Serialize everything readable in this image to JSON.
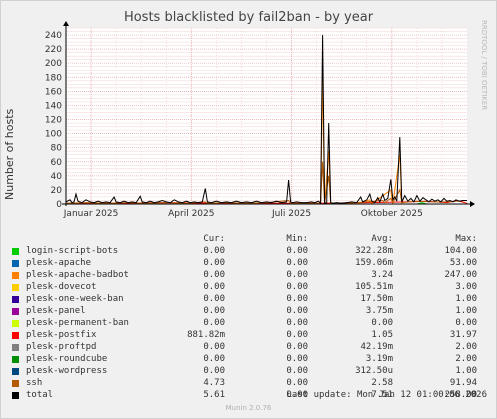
{
  "title": "Hosts blacklisted by fail2ban - by year",
  "watermark": "RRDTOOL / TOBI OETIKER",
  "footer": "Munin 2.0.76",
  "last_update": "Last update: Mon Jan 12 01:00:06 2026",
  "legend_headers": {
    "cur": "Cur:",
    "min": "Min:",
    "avg": "Avg:",
    "max": "Max:"
  },
  "legend": [
    {
      "name": "login-script-bots",
      "color": "#00cc00",
      "cur": "0.00",
      "min": "0.00",
      "avg": "322.28m",
      "max": "104.00"
    },
    {
      "name": "plesk-apache",
      "color": "#0066b3",
      "cur": "0.00",
      "min": "0.00",
      "avg": "159.06m",
      "max": "53.00"
    },
    {
      "name": "plesk-apache-badbot",
      "color": "#ff8000",
      "cur": "0.00",
      "min": "0.00",
      "avg": "3.24",
      "max": "247.00"
    },
    {
      "name": "plesk-dovecot",
      "color": "#ffcc00",
      "cur": "0.00",
      "min": "0.00",
      "avg": "105.51m",
      "max": "3.00"
    },
    {
      "name": "plesk-one-week-ban",
      "color": "#330099",
      "cur": "0.00",
      "min": "0.00",
      "avg": "17.50m",
      "max": "1.00"
    },
    {
      "name": "plesk-panel",
      "color": "#990099",
      "cur": "0.00",
      "min": "0.00",
      "avg": "3.75m",
      "max": "1.00"
    },
    {
      "name": "plesk-permanent-ban",
      "color": "#ccff00",
      "cur": "0.00",
      "min": "0.00",
      "avg": "0.00",
      "max": "0.00"
    },
    {
      "name": "plesk-postfix",
      "color": "#ff0000",
      "cur": "881.82m",
      "min": "0.00",
      "avg": "1.05",
      "max": "31.97"
    },
    {
      "name": "plesk-proftpd",
      "color": "#808080",
      "cur": "0.00",
      "min": "0.00",
      "avg": "42.19m",
      "max": "2.00"
    },
    {
      "name": "plesk-roundcube",
      "color": "#008f00",
      "cur": "0.00",
      "min": "0.00",
      "avg": "3.19m",
      "max": "2.00"
    },
    {
      "name": "plesk-wordpress",
      "color": "#00487d",
      "cur": "0.00",
      "min": "0.00",
      "avg": "312.50u",
      "max": "1.00"
    },
    {
      "name": "ssh",
      "color": "#b35a00",
      "cur": "4.73",
      "min": "0.00",
      "avg": "2.58",
      "max": "91.94"
    },
    {
      "name": "total",
      "color": "#000000",
      "cur": "5.61",
      "min": "0.00",
      "avg": "7.51",
      "max": "258.00"
    }
  ],
  "chart_data": {
    "type": "line",
    "title": "Hosts blacklisted by fail2ban - by year",
    "ylabel": "Number of hosts",
    "ylim": [
      0,
      250
    ],
    "yticks": [
      0,
      20,
      40,
      60,
      80,
      100,
      120,
      140,
      160,
      180,
      200,
      220,
      240
    ],
    "xticks": [
      "Januar 2025",
      "April 2025",
      "Juli 2025",
      "Oktober 2025"
    ],
    "grid": true,
    "x_index_range": [
      0,
      400
    ],
    "xtick_index": [
      25,
      125,
      225,
      325
    ],
    "xminor_index": [
      25,
      50,
      75,
      100,
      125,
      150,
      175,
      200,
      225,
      250,
      275,
      300,
      325,
      350,
      375
    ],
    "series": [
      {
        "name": "total",
        "color": "#000000",
        "points": [
          [
            0,
            3
          ],
          [
            4,
            6
          ],
          [
            6,
            2
          ],
          [
            8,
            3
          ],
          [
            10,
            14
          ],
          [
            12,
            4
          ],
          [
            16,
            2
          ],
          [
            20,
            6
          ],
          [
            24,
            3
          ],
          [
            28,
            2
          ],
          [
            32,
            4
          ],
          [
            36,
            2
          ],
          [
            40,
            3
          ],
          [
            44,
            2
          ],
          [
            48,
            10
          ],
          [
            50,
            3
          ],
          [
            54,
            2
          ],
          [
            58,
            4
          ],
          [
            62,
            2
          ],
          [
            66,
            3
          ],
          [
            70,
            2
          ],
          [
            74,
            11
          ],
          [
            76,
            3
          ],
          [
            80,
            2
          ],
          [
            84,
            4
          ],
          [
            88,
            2
          ],
          [
            92,
            3
          ],
          [
            96,
            5
          ],
          [
            100,
            3
          ],
          [
            104,
            2
          ],
          [
            108,
            6
          ],
          [
            112,
            3
          ],
          [
            116,
            2
          ],
          [
            120,
            4
          ],
          [
            124,
            2
          ],
          [
            128,
            3
          ],
          [
            132,
            2
          ],
          [
            136,
            3
          ],
          [
            139,
            22
          ],
          [
            141,
            3
          ],
          [
            145,
            2
          ],
          [
            150,
            4
          ],
          [
            155,
            2
          ],
          [
            160,
            3
          ],
          [
            165,
            2
          ],
          [
            170,
            4
          ],
          [
            175,
            2
          ],
          [
            180,
            3
          ],
          [
            185,
            2
          ],
          [
            190,
            4
          ],
          [
            195,
            2
          ],
          [
            200,
            3
          ],
          [
            205,
            2
          ],
          [
            210,
            4
          ],
          [
            215,
            2
          ],
          [
            220,
            3
          ],
          [
            222,
            34
          ],
          [
            224,
            3
          ],
          [
            226,
            2
          ],
          [
            230,
            3
          ],
          [
            235,
            2
          ],
          [
            240,
            2
          ],
          [
            245,
            3
          ],
          [
            248,
            2
          ],
          [
            252,
            4
          ],
          [
            254,
            1
          ],
          [
            256,
            240
          ],
          [
            258,
            1
          ],
          [
            260,
            2
          ],
          [
            262,
            115
          ],
          [
            264,
            2
          ],
          [
            266,
            1
          ],
          [
            270,
            2
          ],
          [
            275,
            1
          ],
          [
            280,
            2
          ],
          [
            285,
            3
          ],
          [
            290,
            2
          ],
          [
            294,
            10
          ],
          [
            296,
            3
          ],
          [
            300,
            6
          ],
          [
            303,
            14
          ],
          [
            305,
            4
          ],
          [
            308,
            2
          ],
          [
            311,
            9
          ],
          [
            313,
            3
          ],
          [
            316,
            14
          ],
          [
            318,
            5
          ],
          [
            321,
            8
          ],
          [
            324,
            35
          ],
          [
            326,
            6
          ],
          [
            328,
            10
          ],
          [
            330,
            4
          ],
          [
            333,
            95
          ],
          [
            335,
            3
          ],
          [
            338,
            12
          ],
          [
            341,
            4
          ],
          [
            344,
            8
          ],
          [
            347,
            3
          ],
          [
            350,
            12
          ],
          [
            353,
            4
          ],
          [
            356,
            9
          ],
          [
            359,
            6
          ],
          [
            362,
            3
          ],
          [
            365,
            7
          ],
          [
            368,
            4
          ],
          [
            371,
            6
          ],
          [
            374,
            3
          ],
          [
            377,
            8
          ],
          [
            380,
            4
          ],
          [
            383,
            5
          ],
          [
            386,
            3
          ],
          [
            389,
            6
          ],
          [
            392,
            4
          ],
          [
            396,
            5
          ],
          [
            400,
            5
          ]
        ]
      },
      {
        "name": "ssh",
        "color": "#b35a00",
        "points": [
          [
            0,
            1
          ],
          [
            20,
            2
          ],
          [
            40,
            1
          ],
          [
            60,
            2
          ],
          [
            80,
            1
          ],
          [
            100,
            2
          ],
          [
            120,
            1
          ],
          [
            139,
            3
          ],
          [
            141,
            1
          ],
          [
            160,
            2
          ],
          [
            180,
            1
          ],
          [
            200,
            2
          ],
          [
            222,
            5
          ],
          [
            224,
            1
          ],
          [
            240,
            1
          ],
          [
            254,
            1
          ],
          [
            256,
            60
          ],
          [
            258,
            1
          ],
          [
            262,
            40
          ],
          [
            264,
            1
          ],
          [
            280,
            1
          ],
          [
            300,
            3
          ],
          [
            316,
            5
          ],
          [
            318,
            2
          ],
          [
            324,
            8
          ],
          [
            326,
            2
          ],
          [
            333,
            20
          ],
          [
            335,
            2
          ],
          [
            350,
            4
          ],
          [
            365,
            3
          ],
          [
            380,
            3
          ],
          [
            400,
            5
          ]
        ]
      },
      {
        "name": "plesk-apache-badbot",
        "color": "#ff8000",
        "points": [
          [
            0,
            0
          ],
          [
            250,
            0
          ],
          [
            254,
            0
          ],
          [
            256,
            180
          ],
          [
            258,
            0
          ],
          [
            262,
            75
          ],
          [
            264,
            0
          ],
          [
            290,
            0
          ],
          [
            303,
            6
          ],
          [
            305,
            0
          ],
          [
            324,
            20
          ],
          [
            326,
            0
          ],
          [
            333,
            70
          ],
          [
            335,
            0
          ],
          [
            360,
            0
          ],
          [
            400,
            0
          ]
        ]
      },
      {
        "name": "plesk-postfix",
        "color": "#ff0000",
        "points": [
          [
            0,
            1
          ],
          [
            50,
            1
          ],
          [
            100,
            2
          ],
          [
            150,
            1
          ],
          [
            200,
            1
          ],
          [
            250,
            1
          ],
          [
            300,
            2
          ],
          [
            340,
            3
          ],
          [
            360,
            4
          ],
          [
            380,
            2
          ],
          [
            390,
            5
          ],
          [
            400,
            1
          ]
        ]
      },
      {
        "name": "login-script-bots",
        "color": "#00cc00",
        "points": [
          [
            0,
            0
          ],
          [
            350,
            0
          ],
          [
            355,
            2
          ],
          [
            360,
            0
          ],
          [
            400,
            0
          ]
        ]
      }
    ]
  }
}
